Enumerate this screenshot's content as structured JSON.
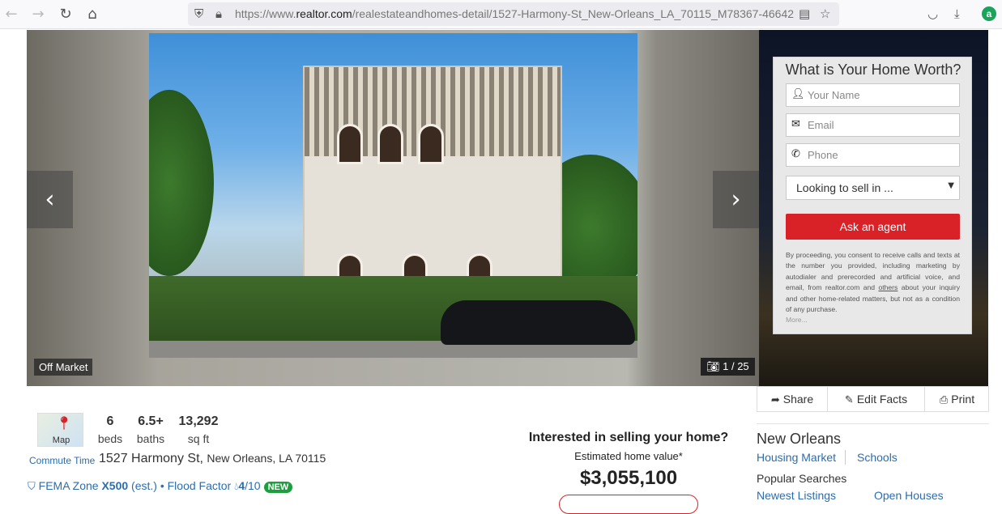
{
  "browser": {
    "url_prefix": "https://www.",
    "url_domain": "realtor.com",
    "url_path": "/realestateandhomes-detail/1527-Harmony-St_New-Orleans_LA_70115_M78367-46642#photo"
  },
  "gallery": {
    "status_label": "Off Market",
    "photo_counter": "1 / 25",
    "prev_arrow": "‹",
    "next_arrow": "›"
  },
  "lead_form": {
    "title": "What is Your Home Worth?",
    "name_placeholder": "Your Name",
    "email_placeholder": "Email",
    "phone_placeholder": "Phone",
    "select_value": "Looking to sell in ...",
    "submit_label": "Ask an agent",
    "consent_before": "By proceeding, you consent to receive calls and texts at the number you provided, including marketing by autodialer and prerecorded and artificial voice, and email, from realtor.com and ",
    "consent_link": "others",
    "consent_after": " about your inquiry and other home-related matters, but not as a condition of any purchase.",
    "more_label": "More..."
  },
  "actions": {
    "share": "Share",
    "edit_facts": "Edit Facts",
    "print": "Print"
  },
  "property": {
    "map_label": "Map",
    "commute_label": "Commute Time",
    "beds": "6",
    "beds_unit": "beds",
    "baths": "6.5+",
    "baths_unit": "baths",
    "sqft": "13,292",
    "sqft_unit": "sq ft",
    "street": "1527 Harmony St",
    "city_state_zip": "New Orleans, LA 70115",
    "fema_prefix": "FEMA Zone ",
    "fema_zone": "X500",
    "fema_suffix": " (est.) • Flood Factor ",
    "flood_factor": "4",
    "flood_factor_max": "/10",
    "new_badge": "NEW"
  },
  "selling": {
    "title": "Interested in selling your home?",
    "subtitle": "Estimated home value*",
    "value": "$3,055,100"
  },
  "local": {
    "city": "New Orleans",
    "housing_market": "Housing Market",
    "schools": "Schools",
    "popular_searches": "Popular Searches",
    "newest_listings": "Newest Listings",
    "open_houses": "Open Houses"
  }
}
